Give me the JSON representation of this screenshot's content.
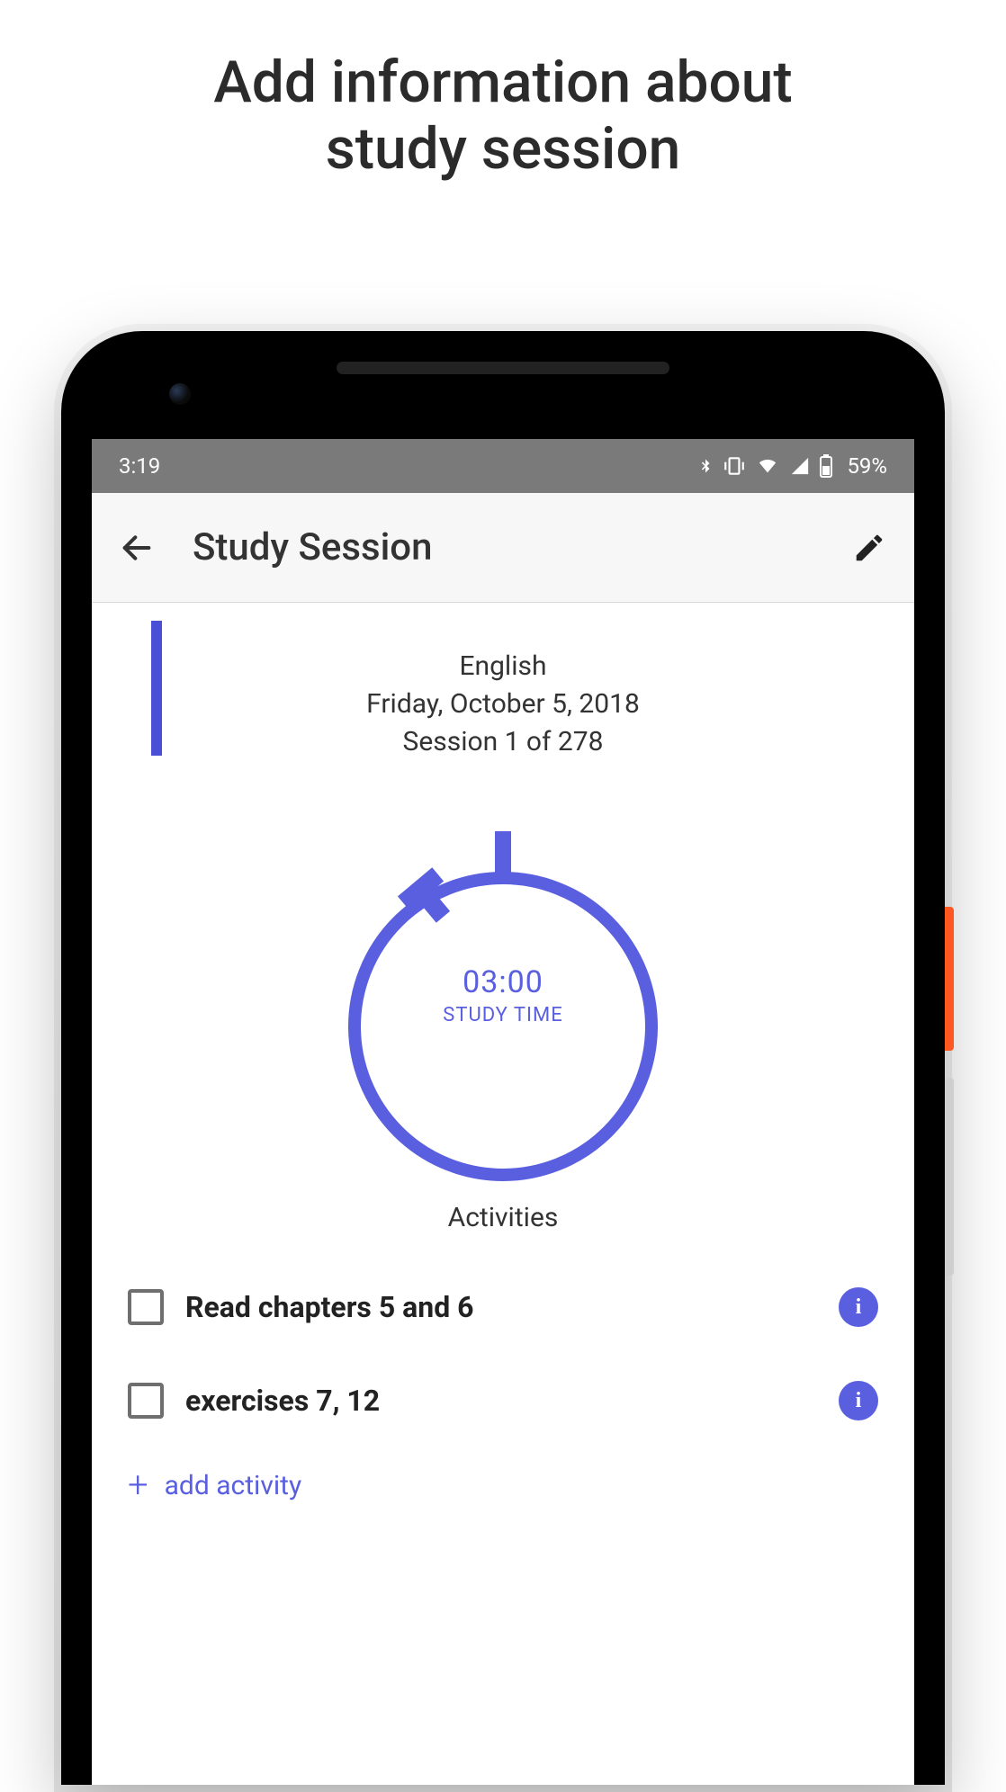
{
  "headline_line1": "Add information about",
  "headline_line2": "study session",
  "status": {
    "time": "3:19",
    "battery_pct": "59%"
  },
  "appbar": {
    "title": "Study Session"
  },
  "session": {
    "subject": "English",
    "date": "Friday, October 5, 2018",
    "progress": "Session 1 of 278"
  },
  "timer": {
    "time": "03:00",
    "label": "STUDY TIME"
  },
  "activities_heading": "Activities",
  "activities": [
    {
      "label": "Read chapters 5 and 6"
    },
    {
      "label": "exercises 7, 12"
    }
  ],
  "add_activity_label": "add activity",
  "colors": {
    "accent": "#5a5fe0"
  }
}
